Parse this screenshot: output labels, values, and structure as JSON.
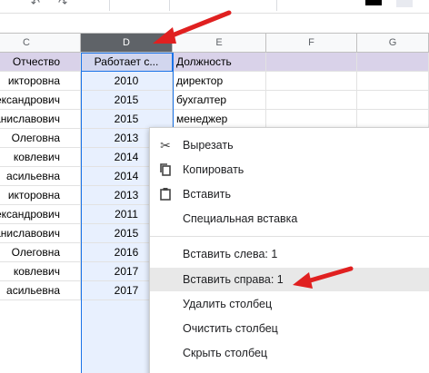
{
  "columns": {
    "c": "C",
    "d": "D",
    "e": "E",
    "f": "F",
    "g": "G"
  },
  "header_row": {
    "c": "Отчество",
    "d": "Работает с...",
    "e": "Должность"
  },
  "rows": [
    {
      "c": "икторовна",
      "d": "2010",
      "e": "директор"
    },
    {
      "c": "лександрович",
      "d": "2015",
      "e": "бухгалтер"
    },
    {
      "c": "ганиславович",
      "d": "2015",
      "e": "менеджер"
    },
    {
      "c": "Олеговна",
      "d": "2013",
      "e": ""
    },
    {
      "c": "ковлевич",
      "d": "2014",
      "e": ""
    },
    {
      "c": "асильевна",
      "d": "2014",
      "e": ""
    },
    {
      "c": "икторовна",
      "d": "2013",
      "e": ""
    },
    {
      "c": "лександрович",
      "d": "2011",
      "e": ""
    },
    {
      "c": "ганиславович",
      "d": "2015",
      "e": ""
    },
    {
      "c": "Олеговна",
      "d": "2016",
      "e": ""
    },
    {
      "c": "ковлевич",
      "d": "2017",
      "e": ""
    },
    {
      "c": "асильевна",
      "d": "2017",
      "e": ""
    }
  ],
  "menu": {
    "cut": "Вырезать",
    "copy": "Копировать",
    "paste": "Вставить",
    "paste_special": "Специальная вставка",
    "insert_left": "Вставить слева: 1",
    "insert_right": "Вставить справа: 1",
    "delete_column": "Удалить столбец",
    "clear_column": "Очистить столбец",
    "hide_column": "Скрыть столбец"
  },
  "colors": {
    "annotation_arrow": "#e02020",
    "selected_header": "#5f6368",
    "selection_fill": "#e8f0fe",
    "header_fill": "#d9d2e9"
  }
}
